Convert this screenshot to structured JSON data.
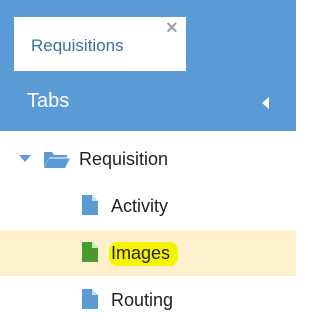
{
  "tab": {
    "label": "Requisitions",
    "close_icon": "×"
  },
  "panel": {
    "title": "Tabs",
    "collapse_icon": "caret-left"
  },
  "tree": {
    "root": {
      "label": "Requisition",
      "icon": "folder-open"
    },
    "children": [
      {
        "label": "Activity",
        "icon": "file",
        "selected": false
      },
      {
        "label": "Images",
        "icon": "file",
        "selected": true
      },
      {
        "label": "Routing",
        "icon": "file",
        "selected": false
      }
    ]
  },
  "colors": {
    "header_bg": "#5b9bd5",
    "selected_row_bg": "#fcf1cc",
    "highlight": "#f5f500",
    "file_icon": "#5b9bd5",
    "file_icon_selected": "#4a9b2c"
  }
}
